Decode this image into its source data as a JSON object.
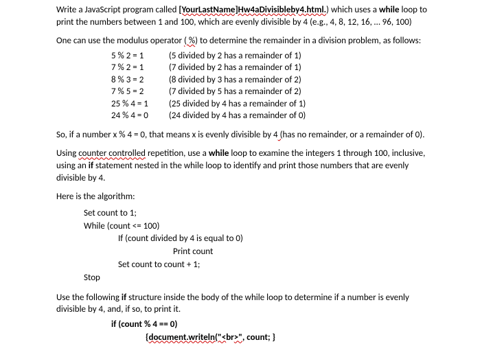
{
  "intro": {
    "p1a": "Write a JavaScript program called ",
    "p1b": "[YourLastName]Hw4aDivisibleby4.html.",
    "p1c": ") which uses a ",
    "p1d": "while",
    "p1e": " loop to print the numbers between 1 and 100, which are evenly divisible by 4 (e.g., 4, 8, 12, 16, … 96, 100)"
  },
  "mod_intro_a": "One can use the modulus operator ",
  "mod_intro_b": "( %",
  "mod_intro_c": ") to determine the remainder in a division problem, as follows:",
  "mod": [
    {
      "expr": "5 % 2 = 1",
      "desc": "(5 divided by 2 has a remainder of 1)"
    },
    {
      "expr": "7 % 2 = 1",
      "desc": "(7 divided by 2 has a remainder of 1)"
    },
    {
      "expr": "8 % 3 = 2",
      "desc": "(8 divided by 3 has a remainder of 2)"
    },
    {
      "expr": "7 % 5 = 2",
      "desc": "(7 divided by 5 has a remainder of 2)"
    },
    {
      "expr": "25 % 4 = 1",
      "desc": "(25 divided by 4 has a remainder of 1)"
    },
    {
      "expr": "24 % 4 = 0",
      "desc": "(24 divided by 4 has a remainder of 0)"
    }
  ],
  "so_a": "So, if a number x % 4 = 0, that means x is evenly divisible by 4",
  "so_b": "  (",
  "so_c": "has no remainder, or a remainder of 0).",
  "using_a": "Using ",
  "using_b": "counter controlled",
  "using_c": " repetition, use a ",
  "using_d": "while",
  "using_e": " loop to examine the integers 1 through 100, inclusive, using an ",
  "using_f": "if",
  "using_g": " statement nested in the while loop to identify and print those numbers that are evenly divisible by 4.",
  "algo_label": "Here is the algorithm:",
  "algo": {
    "l1": "Set count to 1;",
    "l2": "While (count <= 100)",
    "l3": "If (count divided by 4 is equal to 0)",
    "l4": "Print count",
    "l5": "Set count to count + 1;",
    "l6": "Stop"
  },
  "use_a": "Use the following ",
  "use_b": "if",
  "use_c": " structure inside the body of the while loop to determine if a number is evenly divisible by 4, and, if so, to print it.",
  "ifstruct": {
    "l1": "if (count % 4 == 0)",
    "l2a": "{",
    "l2b": "document.writeln(\"<",
    "l2c": "br",
    "l2d": ">\"",
    "l2e": ", count; }"
  }
}
